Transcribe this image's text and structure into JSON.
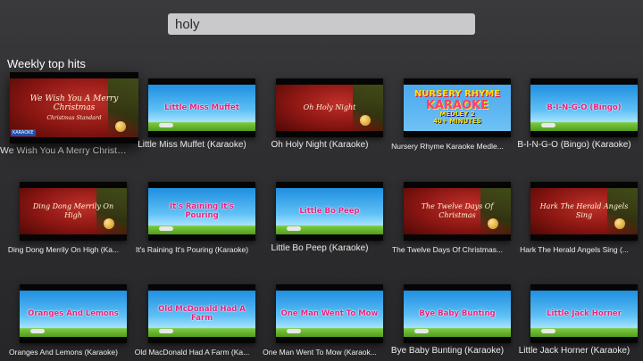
{
  "search": {
    "value": "holy"
  },
  "section": {
    "title": "Weekly top hits"
  },
  "tiles": [
    {
      "title": "We Wish You A Merry Christm...",
      "art_text": "We Wish You A Merry Christmas",
      "art_sub": "Christmas Standard",
      "badge": "KARAOKE",
      "style": "xmas",
      "focused": true
    },
    {
      "title": "Little Miss Muffet (Karaoke)",
      "art_text": "Little Miss Muffet",
      "style": "sky"
    },
    {
      "title": "Oh Holy Night (Karaoke)",
      "art_text": "Oh Holy Night",
      "style": "xmas"
    },
    {
      "title": "Nursery Rhyme Karaoke Medle...",
      "art_text": "NURSERY RHYME",
      "art_text2": "KARAOKE",
      "art_sub": "MEDLEY 2",
      "art_sub2": "40+ MINUTES",
      "style": "nursery"
    },
    {
      "title": "B-I-N-G-O (Bingo) (Karaoke)",
      "art_text": "B-I-N-G-O (Bingo)",
      "style": "sky"
    },
    {
      "title": "Ding Dong Merrily On High (Ka...",
      "art_text": "Ding Dong Merrily On High",
      "style": "xmas"
    },
    {
      "title": "It's Raining It's Pouring (Karaoke)",
      "art_text": "It's Raining It's Pouring",
      "style": "sky"
    },
    {
      "title": "Little Bo Peep (Karaoke)",
      "art_text": "Little Bo Peep",
      "style": "sky"
    },
    {
      "title": "The Twelve Days Of Christmas...",
      "art_text": "The Twelve Days Of Christmas",
      "style": "xmas"
    },
    {
      "title": "Hark The Herald Angels Sing (...",
      "art_text": "Hark The Herald Angels Sing",
      "style": "xmas"
    },
    {
      "title": "Oranges And Lemons (Karaoke)",
      "art_text": "Oranges And Lemons",
      "style": "sky"
    },
    {
      "title": "Old MacDonald Had A Farm (Ka...",
      "art_text": "Old McDonald Had A Farm",
      "style": "sky"
    },
    {
      "title": "One Man Went To Mow (Karaok...",
      "art_text": "One Man Went To Mow",
      "style": "sky"
    },
    {
      "title": "Bye Baby Bunting (Karaoke)",
      "art_text": "Bye Baby Bunting",
      "style": "sky"
    },
    {
      "title": "Little Jack Horner (Karaoke)",
      "art_text": "Little Jack Horner",
      "style": "sky"
    }
  ]
}
